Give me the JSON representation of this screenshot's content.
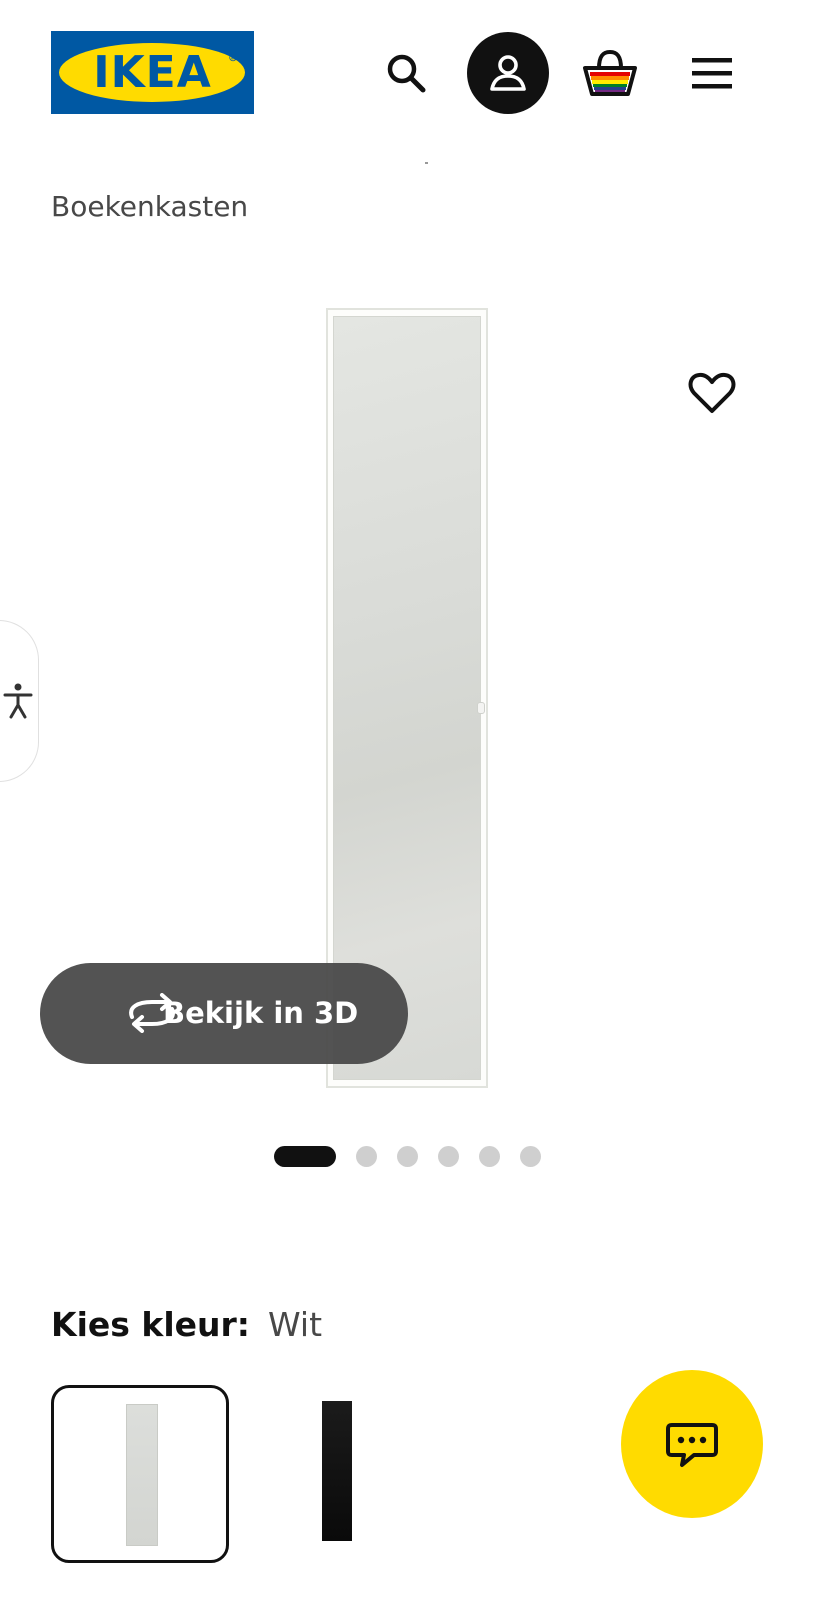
{
  "header": {
    "logo_text": "IKEA",
    "logo_reg": "®",
    "brand_blue": "#0058a3",
    "brand_yellow": "#ffdb00",
    "icons": [
      "search-icon",
      "account-icon",
      "basket-icon",
      "menu-icon"
    ]
  },
  "breadcrumb": {
    "label": "Boekenkasten"
  },
  "gallery": {
    "favorite_icon": "heart-icon",
    "view_3d_label": "Bekijk in 3D",
    "view_3d_icon": "rotate-3d-icon",
    "image_count": 6,
    "active_image": 1
  },
  "accessibility": {
    "icon": "accessibility-icon"
  },
  "color_selector": {
    "label": "Kies kleur:",
    "selected_value": "Wit",
    "options": [
      {
        "name": "Wit",
        "color": "#d8dad6",
        "selected": true
      },
      {
        "name": "Zwart",
        "color": "#111111",
        "selected": false
      }
    ]
  },
  "chat": {
    "icon": "chat-icon",
    "color": "#ffdb00"
  }
}
